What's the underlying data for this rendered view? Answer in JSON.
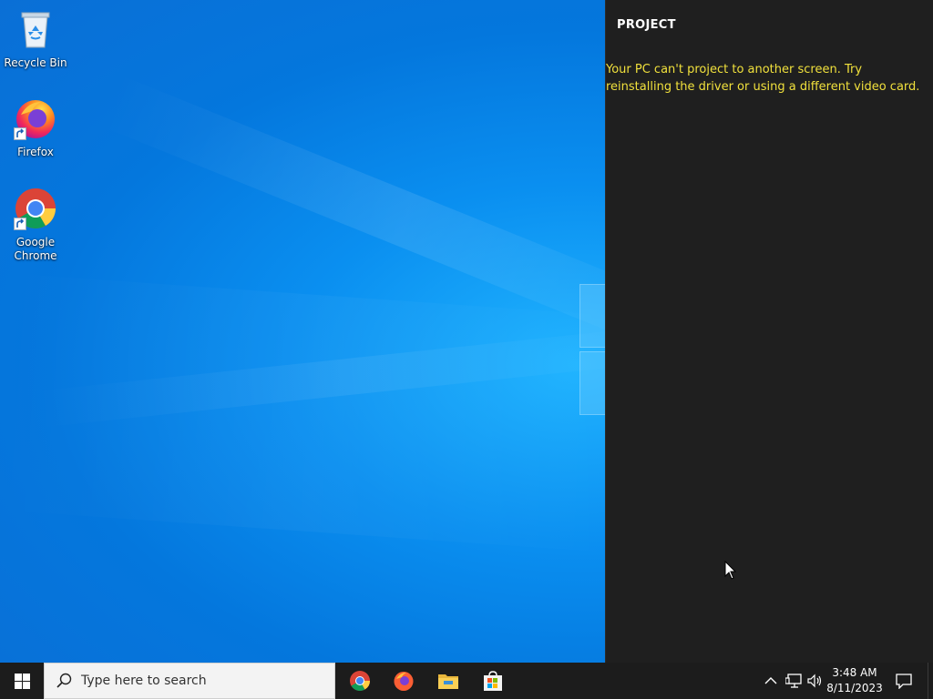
{
  "desktop": {
    "icons": [
      {
        "label": "Recycle Bin",
        "icon": "recycle-bin-icon"
      },
      {
        "label": "Firefox",
        "icon": "firefox-icon"
      },
      {
        "label": "Google Chrome",
        "icon": "chrome-icon"
      }
    ]
  },
  "project_pane": {
    "title": "PROJECT",
    "message": "Your PC can't project to another screen. Try reinstalling the driver or using a different video card.",
    "message_color": "#f0e03c",
    "background": "#1f1f1f"
  },
  "taskbar": {
    "search_placeholder": "Type here to search",
    "pinned_apps": [
      "chrome-icon",
      "firefox-icon",
      "file-explorer-icon",
      "microsoft-store-icon"
    ],
    "tray": {
      "time": "3:48 AM",
      "date": "8/11/2023"
    },
    "background": "#1c1c1c"
  }
}
